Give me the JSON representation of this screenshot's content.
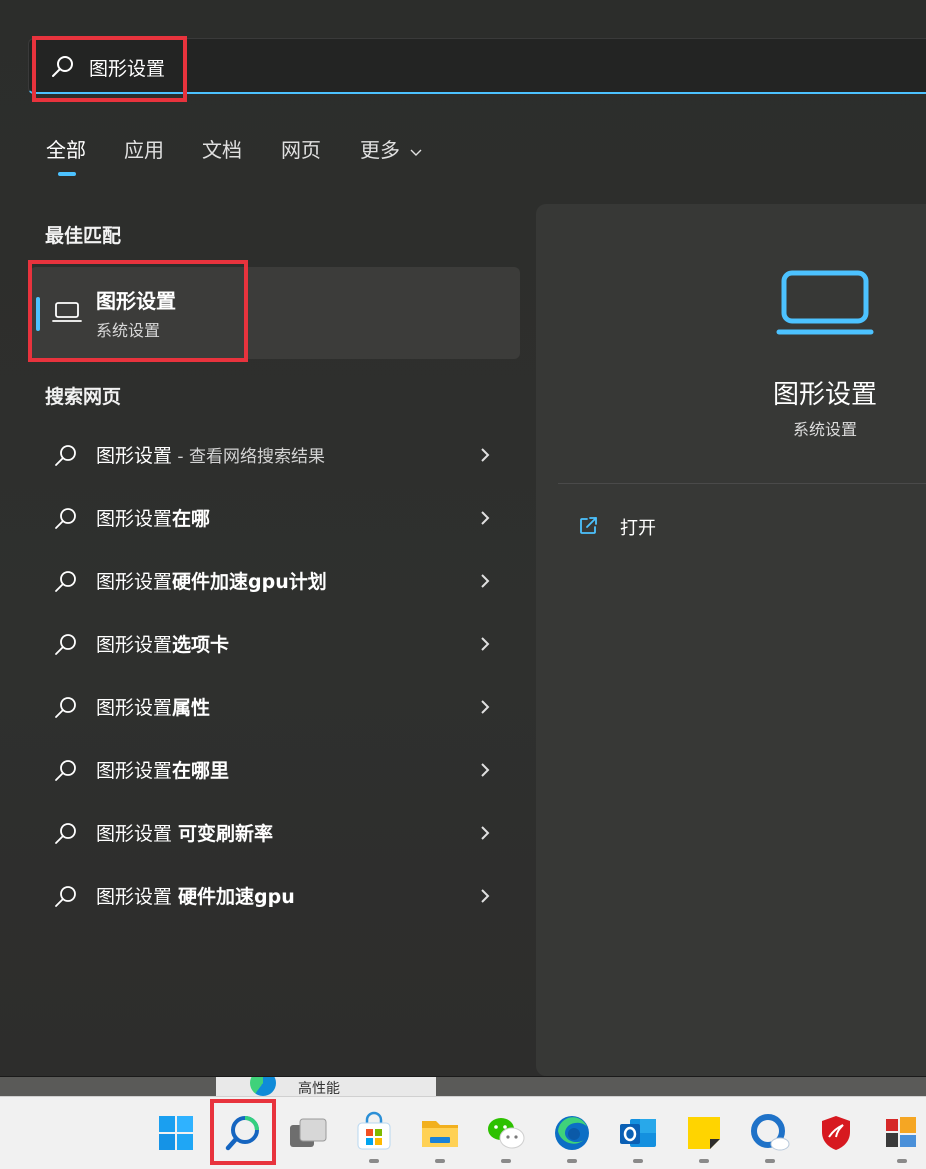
{
  "search": {
    "value": "图形设置"
  },
  "tabs": [
    {
      "label": "全部"
    },
    {
      "label": "应用"
    },
    {
      "label": "文档"
    },
    {
      "label": "网页"
    },
    {
      "label": "更多"
    }
  ],
  "best_match": {
    "section_title": "最佳匹配",
    "title": "图形设置",
    "subtitle": "系统设置"
  },
  "web": {
    "section_title": "搜索网页",
    "results": [
      {
        "prefix": "图形设置",
        "bold": "",
        "suffix": " - 查看网络搜索结果"
      },
      {
        "prefix": "图形设置",
        "bold": "在哪",
        "suffix": ""
      },
      {
        "prefix": "图形设置",
        "bold": "硬件加速gpu计划",
        "suffix": ""
      },
      {
        "prefix": "图形设置",
        "bold": "选项卡",
        "suffix": ""
      },
      {
        "prefix": "图形设置",
        "bold": "属性",
        "suffix": ""
      },
      {
        "prefix": "图形设置",
        "bold": "在哪里",
        "suffix": ""
      },
      {
        "prefix": "图形设置 ",
        "bold": "可变刷新率",
        "suffix": ""
      },
      {
        "prefix": "图形设置 ",
        "bold": "硬件加速gpu",
        "suffix": ""
      }
    ]
  },
  "detail": {
    "title": "图形设置",
    "subtitle": "系统设置",
    "open_label": "打开"
  },
  "background": {
    "partial_text": "高性能"
  },
  "taskbar": {
    "icons": [
      "start-icon",
      "search-icon",
      "task-view-icon",
      "microsoft-store-icon",
      "file-explorer-icon",
      "wechat-icon",
      "edge-icon",
      "outlook-icon",
      "sticky-notes-icon",
      "quickassist-icon",
      "msi-icon",
      "app-icon"
    ]
  },
  "colors": {
    "accent": "#4cc2ff",
    "highlight": "#e8333d",
    "background": "#2e2f2d"
  }
}
